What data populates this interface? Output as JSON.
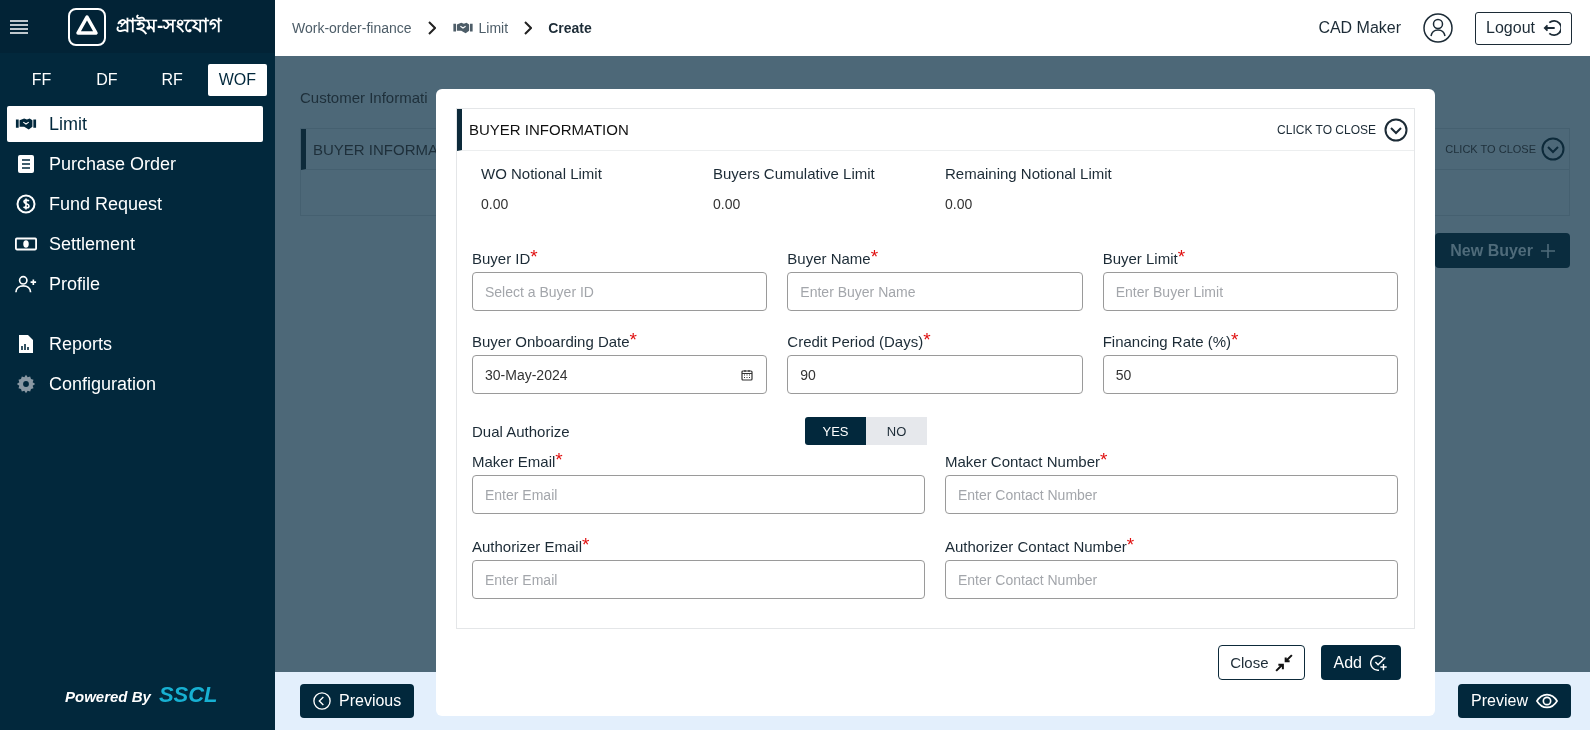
{
  "header": {
    "brand": "প্রাইম-সংযোগ",
    "breadcrumb": [
      {
        "label": "Work-order-finance",
        "kind": "link"
      },
      {
        "label": "Limit",
        "kind": "icon-link"
      },
      {
        "label": "Create",
        "kind": "current"
      }
    ],
    "user": "CAD Maker",
    "logout": "Logout"
  },
  "sidebar": {
    "modules": [
      {
        "label": "FF",
        "selected": false
      },
      {
        "label": "DF",
        "selected": false
      },
      {
        "label": "RF",
        "selected": false
      },
      {
        "label": "WOF",
        "selected": true
      }
    ],
    "main_menu": [
      {
        "label": "Limit",
        "selected": true
      },
      {
        "label": "Purchase Order",
        "selected": false
      },
      {
        "label": "Fund Request",
        "selected": false
      },
      {
        "label": "Settlement",
        "selected": false
      },
      {
        "label": "Profile",
        "selected": false
      }
    ],
    "other_menu": [
      {
        "label": "Reports",
        "selected": false
      },
      {
        "label": "Configuration",
        "selected": false
      }
    ],
    "powered_by": "Powered By",
    "powered_brand": "SSCL"
  },
  "background": {
    "section_title": "Customer Informati",
    "panel_title": "BUYER INFORMA",
    "panel_toggle": "CLICK TO CLOSE",
    "new_buyer": "New Buyer"
  },
  "modal": {
    "title": "BUYER INFORMATION",
    "toggle": "CLICK TO CLOSE",
    "summary": [
      {
        "label": "WO Notional Limit",
        "value": "0.00"
      },
      {
        "label": "Buyers Cumulative Limit",
        "value": "0.00"
      },
      {
        "label": "Remaining Notional Limit",
        "value": "0.00"
      }
    ],
    "fields": [
      {
        "label": "Buyer ID",
        "required_mark": "*",
        "kind": "select",
        "placeholder": "Select a Buyer ID"
      },
      {
        "label": "Buyer Name",
        "required_mark": "*",
        "kind": "text",
        "placeholder": "Enter Buyer Name"
      },
      {
        "label": "Buyer Limit",
        "required_mark": "*",
        "kind": "text",
        "placeholder": "Enter Buyer Limit"
      },
      {
        "label": "Buyer Onboarding Date",
        "required_mark": "*",
        "kind": "date",
        "value": "30-May-2024"
      },
      {
        "label": "Credit Period (Days)",
        "required_mark": "*",
        "kind": "text",
        "value": "90"
      },
      {
        "label": "Financing Rate (%)",
        "required_mark": "*",
        "kind": "text",
        "value": "50"
      }
    ],
    "dual_authorize": {
      "label": "Dual Authorize",
      "options": [
        {
          "label": "YES",
          "selected": true
        },
        {
          "label": "NO",
          "selected": false
        }
      ]
    },
    "contact_fields": [
      {
        "label": "Maker Email",
        "required_mark": "*",
        "kind": "text",
        "placeholder": "Enter Email"
      },
      {
        "label": "Maker Contact Number",
        "required_mark": "*",
        "kind": "text",
        "placeholder": "Enter Contact Number"
      },
      {
        "label": "Authorizer Email",
        "required_mark": "*",
        "kind": "text",
        "placeholder": "Enter Email"
      },
      {
        "label": "Authorizer Contact Number",
        "required_mark": "*",
        "kind": "text",
        "placeholder": "Enter Contact Number"
      }
    ],
    "close": "Close",
    "add": "Add"
  },
  "footer": {
    "previous": "Previous",
    "preview": "Preview"
  }
}
